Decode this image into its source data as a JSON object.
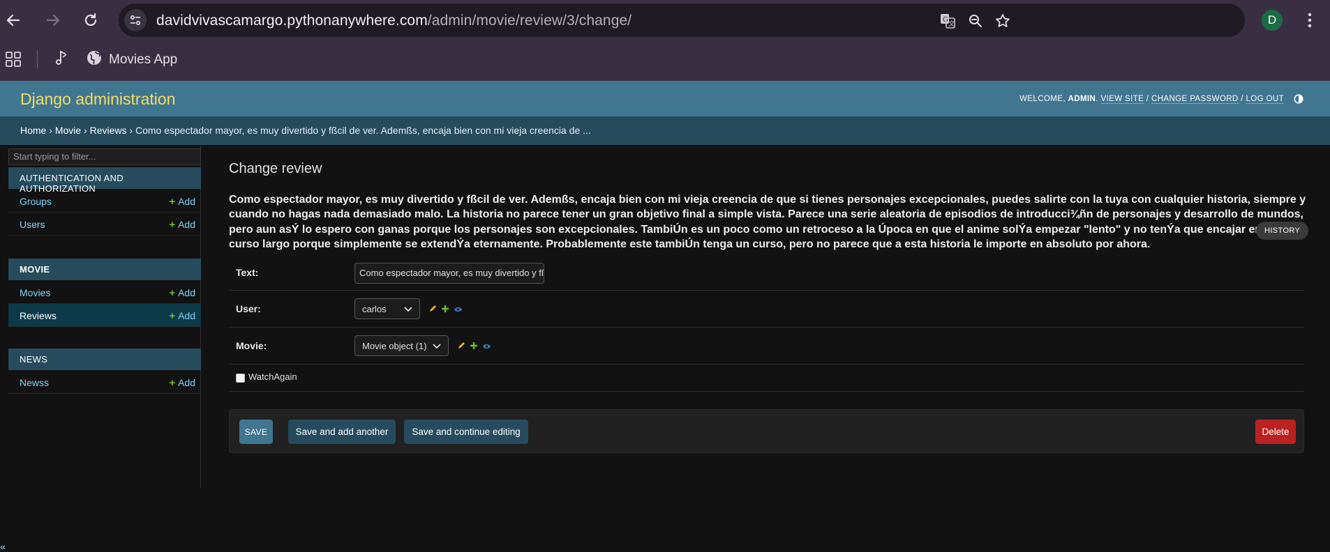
{
  "browser": {
    "url_host": "davidvivascamargo.pythonanywhere.com",
    "url_path": "/admin/movie/review/3/change/",
    "avatar_letter": "D",
    "icons": [
      "back-icon",
      "forward-icon",
      "reload-icon",
      "site-info-icon",
      "translate-icon",
      "zoom-icon",
      "star-icon",
      "menu-icon"
    ]
  },
  "bookmarks": {
    "items": [
      {
        "label": "",
        "icon": "music-icon"
      },
      {
        "label": "Movies App",
        "icon": "globe-icon"
      }
    ]
  },
  "header": {
    "branding": "Django administration",
    "welcome": "WELCOME,",
    "username": "ADMIN",
    "view_site": "VIEW SITE",
    "change_password": "CHANGE PASSWORD",
    "log_out": "LOG OUT"
  },
  "breadcrumbs": {
    "home": "Home",
    "app": "Movie",
    "model": "Reviews",
    "current": "Como espectador mayor, es muy divertido y fßcil de ver. Ademßs, encaja bien con mi vieja creencia de ..."
  },
  "sidebar": {
    "filter_placeholder": "Start typing to filter...",
    "add_label": "Add",
    "collapse_label": "«",
    "modules": [
      {
        "caption": "AUTHENTICATION AND AUTHORIZATION",
        "models": [
          "Groups",
          "Users"
        ]
      },
      {
        "caption": "MOVIE",
        "models": [
          "Movies",
          "Reviews"
        ],
        "current": "Reviews"
      },
      {
        "caption": "NEWS",
        "models": [
          "Newss"
        ]
      }
    ]
  },
  "content": {
    "title": "Change review",
    "subtitle": "Como espectador mayor, es muy divertido y fßcil de ver. Ademßs, encaja bien con mi vieja creencia de que si tienes personajes excepcionales, puedes salirte con la tuya con cualquier historia, siempre y cuando no hagas nada demasiado malo. La historia no parece tener un gran objetivo final a simple vista. Parece una serie aleatoria de episodios de introducci¾ñn de personajes y desarrollo de mundos, pero aun asÝ lo espero con ganas porque los personajes son excepcionales. TambiÚn es un poco como un retroceso a la Úpoca en que el anime solÝa empezar \"lento\" y no tenÝa que encajar en un curso largo porque simplemente se extendÝa eternamente. Probablemente este tambiÚn tenga un curso, pero no parece que a esta historia le importe en absoluto por ahora.",
    "history": "HISTORY"
  },
  "form": {
    "text_label": "Text:",
    "text_value": "Como espectador mayor, es muy divertido y fßcil de ver.",
    "user_label": "User:",
    "user_value": "carlos",
    "movie_label": "Movie:",
    "movie_value": "Movie object (1)",
    "watch_again_label": "WatchAgain",
    "watch_again_checked": false
  },
  "buttons": {
    "save": "SAVE",
    "save_add_another": "Save and add another",
    "save_continue": "Save and continue editing",
    "delete": "Delete"
  },
  "colors": {
    "header_bg": "#417690",
    "branding": "#f5dd5d",
    "breadcrumbs_bg": "#264b5d",
    "link": "#81d4fa",
    "add_plus": "#70bf2b",
    "delete": "#ba2121",
    "chrome": "#3a2f42"
  }
}
